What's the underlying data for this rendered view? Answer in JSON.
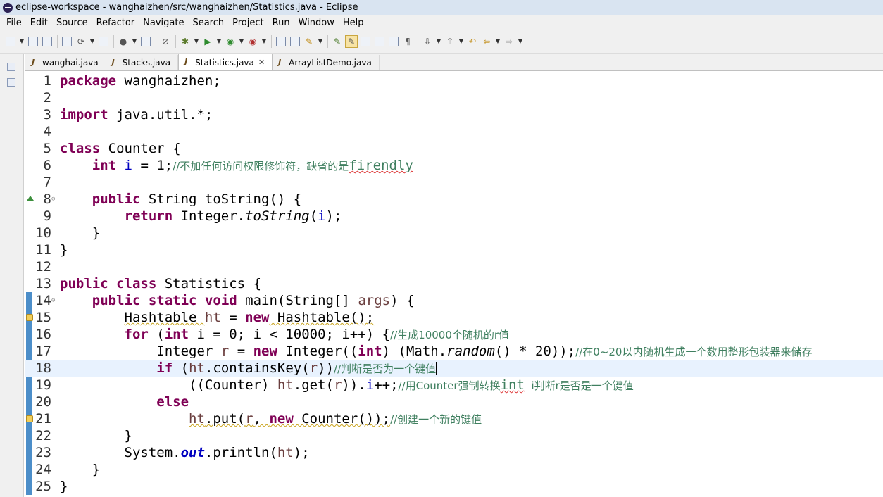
{
  "window": {
    "title": "eclipse-workspace - wanghaizhen/src/wanghaizhen/Statistics.java - Eclipse"
  },
  "menu": [
    "File",
    "Edit",
    "Source",
    "Refactor",
    "Navigate",
    "Search",
    "Project",
    "Run",
    "Window",
    "Help"
  ],
  "tabs": [
    {
      "label": "wanghai.java",
      "active": false
    },
    {
      "label": "Stacks.java",
      "active": false
    },
    {
      "label": "Statistics.java",
      "active": true
    },
    {
      "label": "ArrayListDemo.java",
      "active": false
    }
  ],
  "editor": {
    "current_line": 18,
    "line_numbers": [
      "1",
      "2",
      "3",
      "4",
      "5",
      "6",
      "7",
      "8",
      "9",
      "10",
      "11",
      "12",
      "13",
      "14",
      "15",
      "16",
      "17",
      "18",
      "19",
      "20",
      "21",
      "22",
      "23",
      "24",
      "25"
    ],
    "code": {
      "l1_kw": "package",
      "l1_rest": " wanghaizhen;",
      "l3_kw": "import",
      "l3_rest": " java.util.*;",
      "l5_kw": "class",
      "l5_rest": " Counter {",
      "l6_indent": "    ",
      "l6_kw": "int",
      "l6_sp": " ",
      "l6_fd": "i",
      "l6_rest": " = 1;",
      "l6_cm": "//不加任何访问权限修饰符，缺省的是",
      "l6_cm2": "firendly",
      "l8_indent": "    ",
      "l8_kw": "public",
      "l8_rest": " String toString() {",
      "l9_indent": "        ",
      "l9_kw": "return",
      "l9_a": " Integer.",
      "l9_it": "toString",
      "l9_b": "(",
      "l9_fd": "i",
      "l9_c": ");",
      "l10": "    }",
      "l11": "}",
      "l13_kw1": "public",
      "l13_kw2": "class",
      "l13_rest": " Statistics {",
      "l14_indent": "    ",
      "l14_kw1": "public",
      "l14_kw2": "static",
      "l14_kw3": "void",
      "l14_a": " main(String[] ",
      "l14_lv": "args",
      "l14_b": ") {",
      "l15_indent": "        ",
      "l15_a": "Hashtable ",
      "l15_lv": "ht",
      "l15_b": " = ",
      "l15_kw": "new",
      "l15_c": " Hashtable();",
      "l16_indent": "        ",
      "l16_kw1": "for",
      "l16_a": " (",
      "l16_kw2": "int",
      "l16_b": " i = 0; i < 10000; i++) {",
      "l16_cm": "//生成10000个随机的r值",
      "l17_indent": "            ",
      "l17_a": "Integer ",
      "l17_lv": "r",
      "l17_b": " = ",
      "l17_kw": "new",
      "l17_c": " Integer((",
      "l17_kw2": "int",
      "l17_d": ") (Math.",
      "l17_it": "random",
      "l17_e": "() * 20));",
      "l17_cm": "//在0~20以内随机生成一个数用整形包装器来储存",
      "l18_indent": "            ",
      "l18_kw": "if",
      "l18_a": " (",
      "l18_lv": "ht",
      "l18_b": ".containsKey(",
      "l18_lv2": "r",
      "l18_c": "))",
      "l18_cm": "//判断是否为一个键值",
      "l19_indent": "                ",
      "l19_a": "((Counter) ",
      "l19_lv": "ht",
      "l19_b": ".get(",
      "l19_lv2": "r",
      "l19_c": ")).",
      "l19_fd": "i",
      "l19_d": "++;",
      "l19_cm": "//用Counter强制转换",
      "l19_cm2": "int",
      "l19_cm3": "  i判断r是否是一个键值",
      "l20_indent": "            ",
      "l20_kw": "else",
      "l21_indent": "                ",
      "l21_lv": "ht",
      "l21_a": ".put(",
      "l21_lv2": "r",
      "l21_b": ", ",
      "l21_kw": "new",
      "l21_c": " Counter());",
      "l21_cm": "//创建一个新的键值",
      "l22": "        }",
      "l23_indent": "        ",
      "l23_a": "System.",
      "l23_st": "out",
      "l23_b": ".println(",
      "l23_lv": "ht",
      "l23_c": ");",
      "l24": "    }",
      "l25": "}"
    }
  },
  "icons": {
    "override": "override-triangle-icon",
    "warning": "warning-bulb-icon"
  }
}
